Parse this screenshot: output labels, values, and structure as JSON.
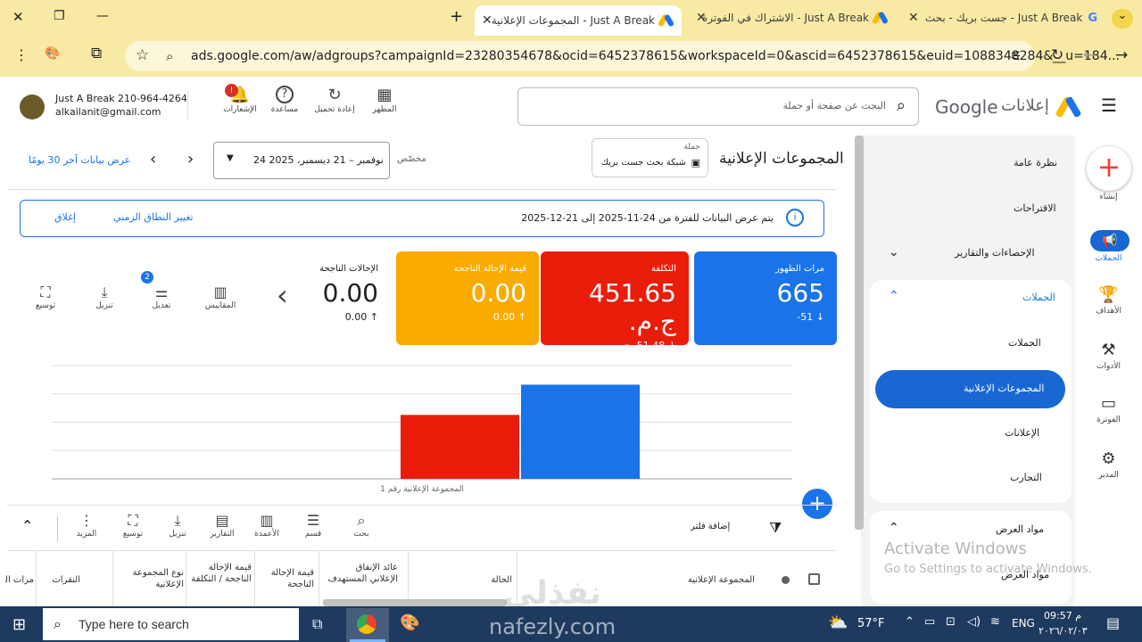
{
  "tabs": [
    {
      "title": "Just A Break - المجموعات الإعلانية",
      "close": "✕"
    },
    {
      "title": "Just A Break - الاشتراك في الفوترة",
      "close": "✕"
    },
    {
      "title": "Just A Break - جست بريك - بحث",
      "close": "✕"
    }
  ],
  "window": {
    "close": "✕",
    "restore": "❐",
    "minimize": "—",
    "new_tab": "+",
    "menu": "⌄"
  },
  "address": {
    "url": "ads.google.com/aw/adgroups?campaignId=23280354678&ocid=6452378615&workspaceId=0&ascid=6452378615&euid=1088348284&__u=184..."
  },
  "account": {
    "name": "Just A Break 210-964-4264",
    "email": "alkailanit@gmail.com"
  },
  "header_icons": [
    {
      "label": "الإشعارات",
      "glyph": "🔔",
      "badge": "!"
    },
    {
      "label": "مساعدة",
      "glyph": "?"
    },
    {
      "label": "إعادة تحميل",
      "glyph": "↻"
    },
    {
      "label": "المظهر",
      "glyph": "▦"
    }
  ],
  "search": {
    "placeholder": "البحث عن صفحة أو حملة"
  },
  "brand": {
    "google": "Google",
    "product": "إعلانات"
  },
  "rail": [
    {
      "label": "إنشاء",
      "icon": "plus-icon"
    },
    {
      "label": "الحملات",
      "icon": "megaphone-icon"
    },
    {
      "label": "الأهداف",
      "icon": "trophy-icon"
    },
    {
      "label": "الأدوات",
      "icon": "tools-icon"
    },
    {
      "label": "الفوترة",
      "icon": "card-icon"
    },
    {
      "label": "المدير",
      "icon": "gear-icon"
    }
  ],
  "nav": {
    "overview": "نظرة عامة",
    "recommendations": "الاقتراحات",
    "stats": "الإحصاءات والتقارير",
    "campaigns_section": "الحملات",
    "campaigns": "الحملات",
    "adgroups": "المجموعات الإعلانية",
    "ads": "الإعلانات",
    "experiments": "التجارب",
    "assets_section": "مواد العرض",
    "assets": "مواد العرض"
  },
  "page": {
    "title": "المجموعات الإعلانية",
    "campaign_label": "حملة",
    "campaign_name": "شبكة بحث جست بريك",
    "range_type": "مخصّص",
    "date_range": "24 نوفمبر – 21 ديسمبر، 2025",
    "last30": "عرض بيانات آخر 30 يومًا"
  },
  "banner": {
    "text": "يتم عرض البيانات للفترة من 24-11-2025 إلى 21-12-2025",
    "change": "تغيير النطاق الزمني",
    "dismiss": "إغلاق"
  },
  "kpis": [
    {
      "label": "مرات الظهور",
      "value": "665",
      "change": "51-",
      "color": "#1a73e8"
    },
    {
      "label": "التكلفة",
      "value": "451.65 ج.م.",
      "change": "51.48- ج.م.",
      "color": "#ea1c0a"
    },
    {
      "label": "قيمة الإحالة الناجحة",
      "value": "0.00",
      "change": "0.00",
      "color": "#f9ab00"
    },
    {
      "label": "الإحالات الناجحة",
      "value": "0.00",
      "change": "0.00",
      "color": "#ffffff"
    }
  ],
  "chart_tools": [
    {
      "label": "المقاييس",
      "glyph": "▥"
    },
    {
      "label": "تعديل",
      "glyph": "⚌",
      "badge": "2"
    },
    {
      "label": "تنزيل",
      "glyph": "⤓"
    },
    {
      "label": "توسيع",
      "glyph": "⛶"
    }
  ],
  "chart_data": {
    "type": "bar",
    "categories": [
      "المجموعة الإعلانية رقم 1"
    ],
    "series": [
      {
        "name": "مرات الظهور",
        "values": [
          665
        ],
        "color": "#1a73e8"
      },
      {
        "name": "التكلفة",
        "values": [
          451.65
        ],
        "color": "#ea1c0a"
      }
    ],
    "ylim": [
      0,
      800
    ],
    "grid": true
  },
  "table_toolbar": {
    "add_filter": "إضافة فلتر",
    "items": [
      {
        "label": "بحث",
        "glyph": "⌕"
      },
      {
        "label": "قسم",
        "glyph": "☰"
      },
      {
        "label": "الأعمدة",
        "glyph": "▥"
      },
      {
        "label": "التقارير",
        "glyph": "▤"
      },
      {
        "label": "تنزيل",
        "glyph": "⤓"
      },
      {
        "label": "توسيع",
        "glyph": "⛶"
      },
      {
        "label": "المزيد",
        "glyph": "⋮"
      }
    ]
  },
  "columns": [
    "المجموعة الإعلانية",
    "الحالة",
    "عائد الإنفاق الإعلاني المستهدف",
    "قيمة الإحالة الناجحة",
    "قيمة الإحالة الناجحة / التكلفة",
    "نوع المجموعة الإعلانية",
    "النقرات",
    "مرات الظهور"
  ],
  "watermark": {
    "line1": "Activate Windows",
    "line2": "Go to Settings to activate Windows."
  },
  "overlay": {
    "site": "nafezly.com"
  },
  "taskbar": {
    "search_placeholder": "Type here to search",
    "weather": "57°F",
    "lang": "ENG",
    "time": "09:57 م",
    "date": "٢٠٢٦/٠٢/٠٣"
  }
}
